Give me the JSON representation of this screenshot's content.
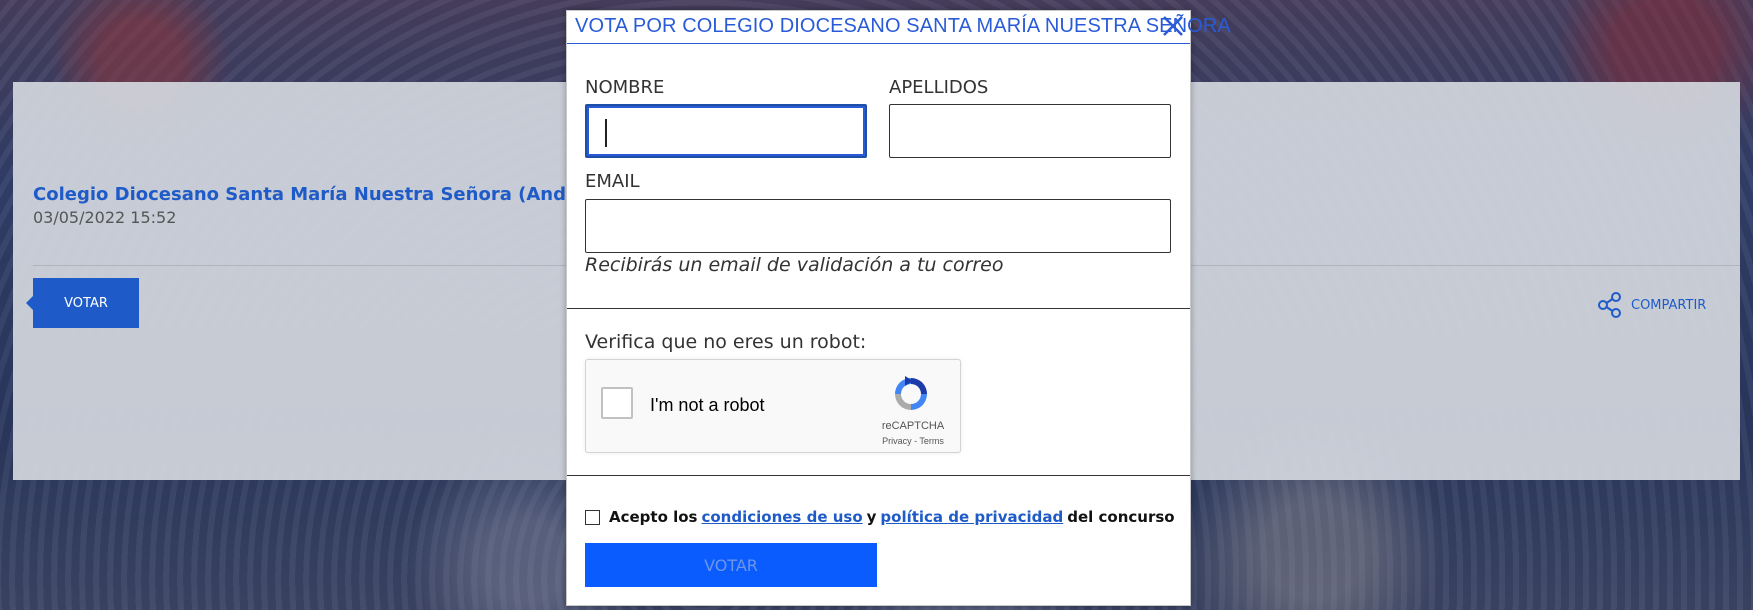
{
  "page": {
    "school_name": "Colegio Diocesano Santa María Nuestra Señora (Andalucía)",
    "date": "03/05/2022 15:52",
    "vote_button": "VOTAR",
    "share_label": "COMPARTIR"
  },
  "modal": {
    "title": "VOTA POR COLEGIO DIOCESANO SANTA MARÍA NUESTRA SEÑORA",
    "fields": {
      "nombre_label": "NOMBRE",
      "nombre_value": "",
      "apellidos_label": "APELLIDOS",
      "apellidos_value": "",
      "email_label": "EMAIL",
      "email_value": "",
      "email_hint": "Recibirás un email de validación a tu correo"
    },
    "robot_label": "Verifica que no eres un robot:",
    "recaptcha": {
      "checkbox_text": "I'm not a robot",
      "brand": "reCAPTCHA",
      "links": "Privacy - Terms"
    },
    "accept": {
      "prefix": "Acepto los",
      "terms_link": "condiciones de uso",
      "and": "y",
      "privacy_link": "política de privacidad",
      "suffix": "del concurso",
      "checked": false
    },
    "submit_label": "VOTAR"
  },
  "colors": {
    "accent": "#1f5bc8",
    "submit_bg": "#0a5cff"
  }
}
